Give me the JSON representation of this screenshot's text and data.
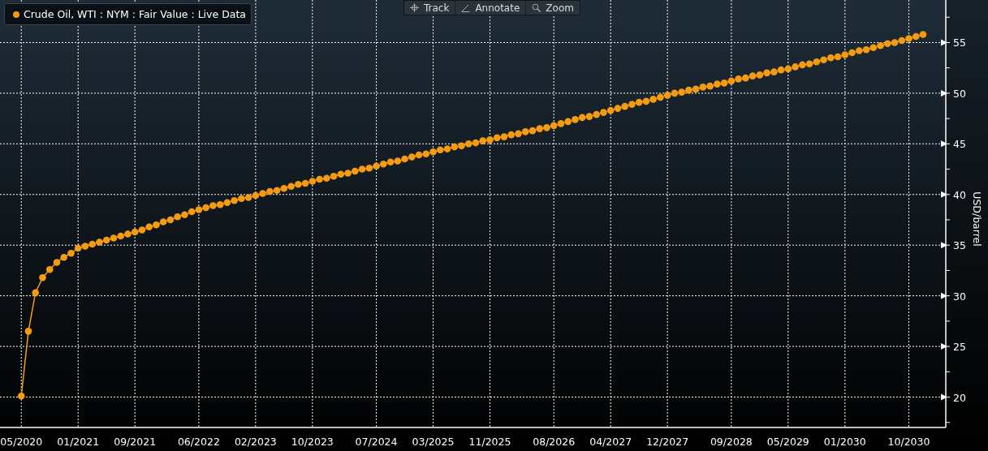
{
  "toolbar": [
    {
      "kind": "track",
      "label": "Track"
    },
    {
      "kind": "annotate",
      "label": "Annotate"
    },
    {
      "kind": "zoom",
      "label": "Zoom"
    }
  ],
  "chart_data": {
    "type": "line",
    "grid": true,
    "categories": [
      "05/2020",
      null,
      null,
      null,
      null,
      null,
      null,
      null,
      "01/2021",
      null,
      null,
      null,
      null,
      null,
      null,
      null,
      "09/2021",
      null,
      null,
      null,
      null,
      null,
      null,
      null,
      null,
      "06/2022",
      null,
      null,
      null,
      null,
      null,
      null,
      null,
      "02/2023",
      null,
      null,
      null,
      null,
      null,
      null,
      null,
      "10/2023",
      null,
      null,
      null,
      null,
      null,
      null,
      null,
      null,
      "07/2024",
      null,
      null,
      null,
      null,
      null,
      null,
      null,
      "03/2025",
      null,
      null,
      null,
      null,
      null,
      null,
      null,
      "11/2025",
      null,
      null,
      null,
      null,
      null,
      null,
      null,
      null,
      "08/2026",
      null,
      null,
      null,
      null,
      null,
      null,
      null,
      "04/2027",
      null,
      null,
      null,
      null,
      null,
      null,
      null,
      "12/2027",
      null,
      null,
      null,
      null,
      null,
      null,
      null,
      null,
      "09/2028",
      null,
      null,
      null,
      null,
      null,
      null,
      null,
      "05/2029",
      null,
      null,
      null,
      null,
      null,
      null,
      null,
      "01/2030",
      null,
      null,
      null,
      null,
      null,
      null,
      null,
      null,
      "10/2030",
      null,
      null
    ],
    "ylabel": "USD/barrel",
    "ylim": [
      17,
      59.2
    ],
    "yticks": [
      20,
      25,
      30,
      35,
      40,
      45,
      50,
      55
    ],
    "series": [
      {
        "name": "Crude Oil, WTI : NYM : Fair Value : Live Data",
        "color": "#f39c12",
        "marker": "circle",
        "values": [
          20.1,
          26.5,
          30.3,
          31.8,
          32.6,
          33.3,
          33.8,
          34.2,
          34.7,
          34.9,
          35.1,
          35.3,
          35.5,
          35.7,
          35.9,
          36.1,
          36.3,
          36.5,
          36.8,
          37.0,
          37.3,
          37.5,
          37.8,
          38.0,
          38.3,
          38.5,
          38.7,
          38.9,
          39.0,
          39.2,
          39.4,
          39.6,
          39.7,
          39.9,
          40.1,
          40.3,
          40.4,
          40.6,
          40.8,
          41.0,
          41.1,
          41.3,
          41.5,
          41.6,
          41.8,
          42.0,
          42.1,
          42.3,
          42.5,
          42.6,
          42.8,
          43.0,
          43.2,
          43.3,
          43.5,
          43.7,
          43.9,
          44.0,
          44.2,
          44.4,
          44.5,
          44.7,
          44.8,
          45.0,
          45.1,
          45.3,
          45.4,
          45.6,
          45.7,
          45.9,
          46.0,
          46.2,
          46.3,
          46.5,
          46.6,
          46.8,
          47.0,
          47.2,
          47.4,
          47.6,
          47.7,
          47.9,
          48.1,
          48.3,
          48.5,
          48.7,
          48.9,
          49.1,
          49.2,
          49.4,
          49.6,
          49.8,
          50.0,
          50.1,
          50.3,
          50.4,
          50.6,
          50.7,
          50.9,
          51.0,
          51.2,
          51.4,
          51.5,
          51.7,
          51.8,
          52.0,
          52.1,
          52.3,
          52.4,
          52.6,
          52.8,
          52.9,
          53.1,
          53.3,
          53.5,
          53.6,
          53.8,
          54.0,
          54.2,
          54.3,
          54.5,
          54.7,
          54.9,
          55.0,
          55.2,
          55.4,
          55.6,
          55.8
        ]
      }
    ]
  }
}
